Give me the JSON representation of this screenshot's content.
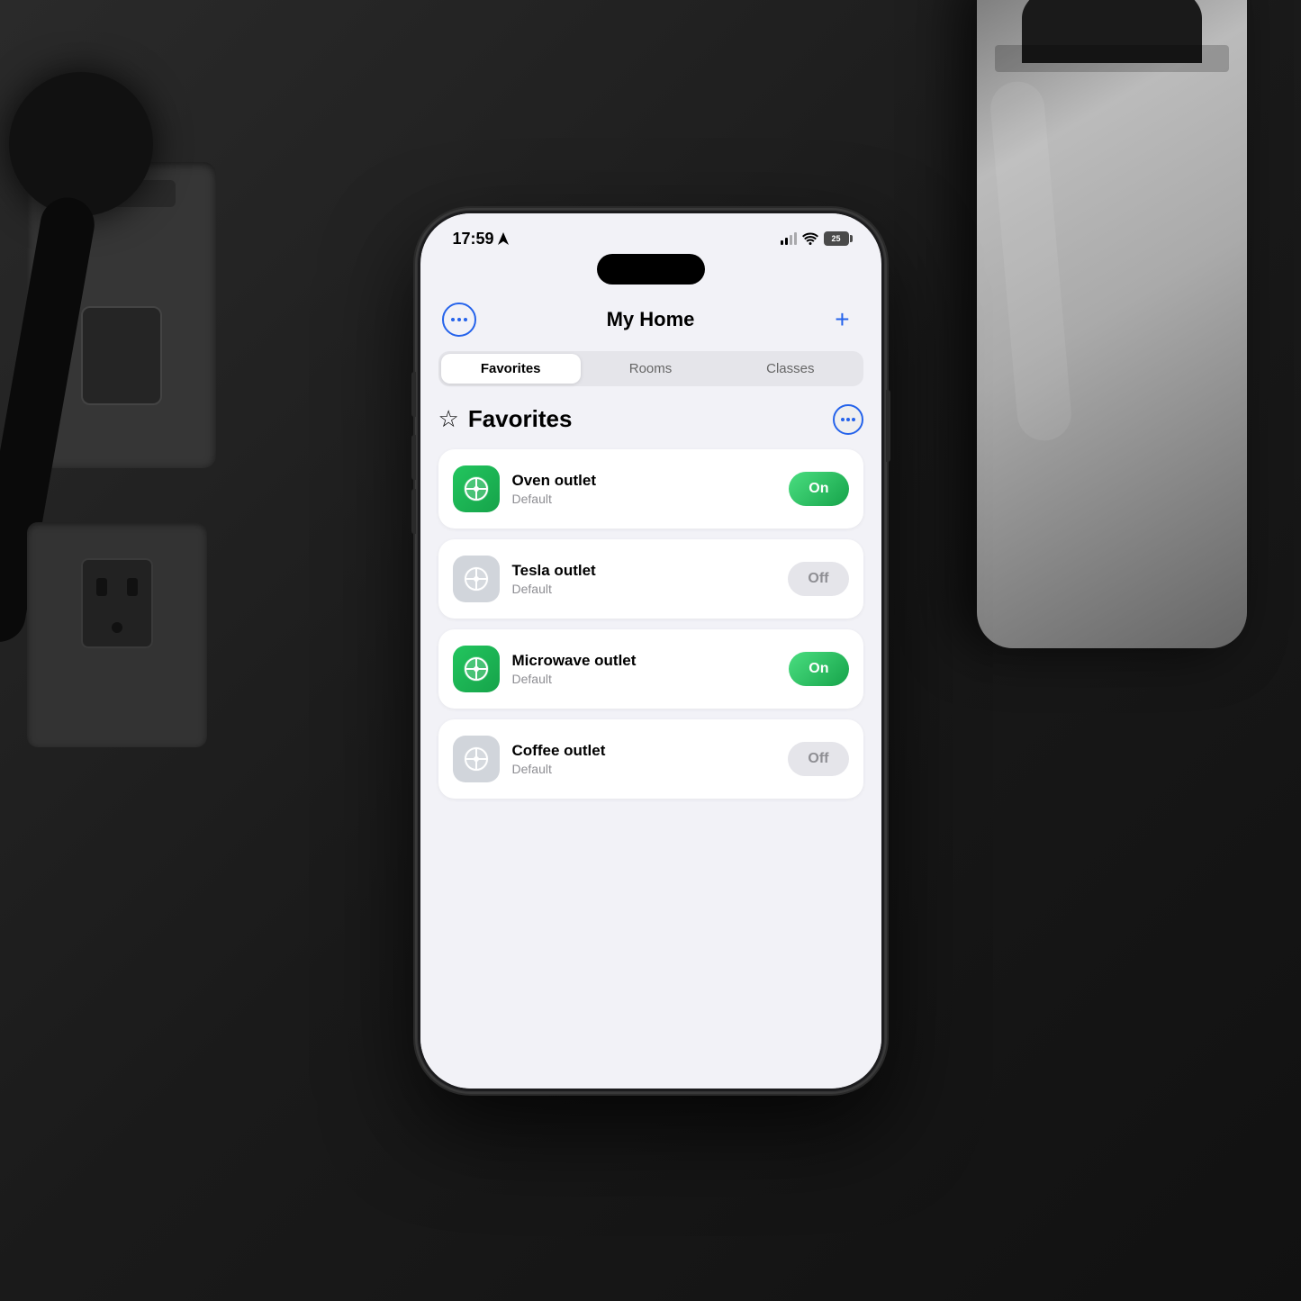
{
  "background": {
    "color": "#1a1a1a"
  },
  "statusBar": {
    "time": "17:59",
    "battery": "25"
  },
  "header": {
    "title": "My Home",
    "menuLabel": "...",
    "addLabel": "+"
  },
  "tabs": [
    {
      "id": "favorites",
      "label": "Favorites",
      "active": true
    },
    {
      "id": "rooms",
      "label": "Rooms",
      "active": false
    },
    {
      "id": "classes",
      "label": "Classes",
      "active": false
    }
  ],
  "favoritesSection": {
    "title": "Favorites",
    "moreLabel": "..."
  },
  "devices": [
    {
      "id": "oven-outlet",
      "name": "Oven outlet",
      "subtitle": "Default",
      "state": "on",
      "toggleLabel": "On",
      "iconActive": true
    },
    {
      "id": "tesla-outlet",
      "name": "Tesla outlet",
      "subtitle": "Default",
      "state": "off",
      "toggleLabel": "Off",
      "iconActive": false
    },
    {
      "id": "microwave-outlet",
      "name": "Microwave outlet",
      "subtitle": "Default",
      "state": "on",
      "toggleLabel": "On",
      "iconActive": true
    },
    {
      "id": "coffee-outlet",
      "name": "Coffee outlet",
      "subtitle": "Default",
      "state": "off",
      "toggleLabel": "Off",
      "iconActive": false
    }
  ]
}
